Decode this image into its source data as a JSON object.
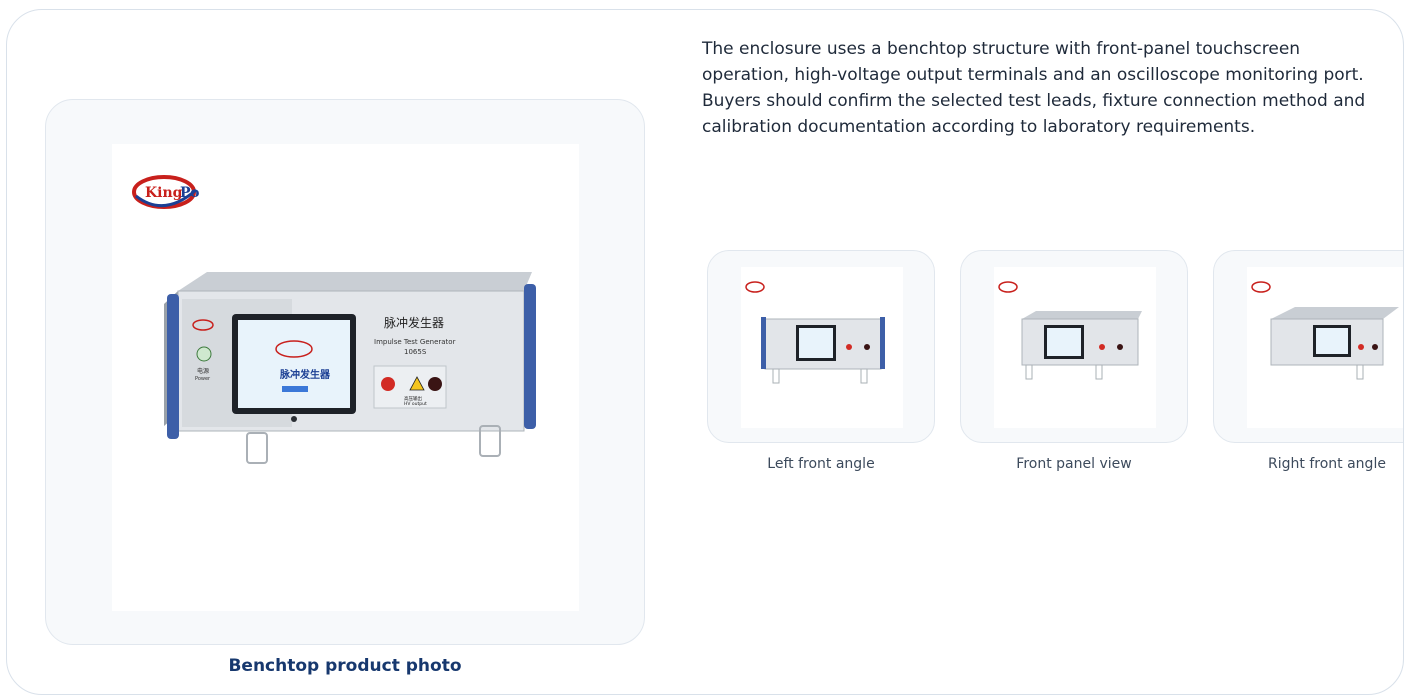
{
  "description": "The enclosure uses a benchtop structure with front-panel touchscreen operation, high-voltage output terminals and an oscilloscope monitoring port. Buyers should confirm the selected test leads, fixture connection method and calibration documentation according to laboratory requirements.",
  "main_image": {
    "caption": "Benchtop product photo",
    "logo_text": "KingPo",
    "device_title": "脉冲发生器",
    "device_subtitle": "Impulse Test Generator",
    "device_model": "1065S",
    "screen_title": "脉冲发生器",
    "power_label_cn": "电源",
    "power_label_en": "Power",
    "output_label_cn": "高压输出",
    "output_label_en": "HV output"
  },
  "thumbnails": [
    {
      "caption": "Left front angle"
    },
    {
      "caption": "Front panel view"
    },
    {
      "caption": "Right front angle"
    }
  ],
  "colors": {
    "caption_blue": "#17386e",
    "border": "#d9e1ea",
    "logo_red": "#c8201c",
    "logo_blue": "#1b3f94"
  }
}
